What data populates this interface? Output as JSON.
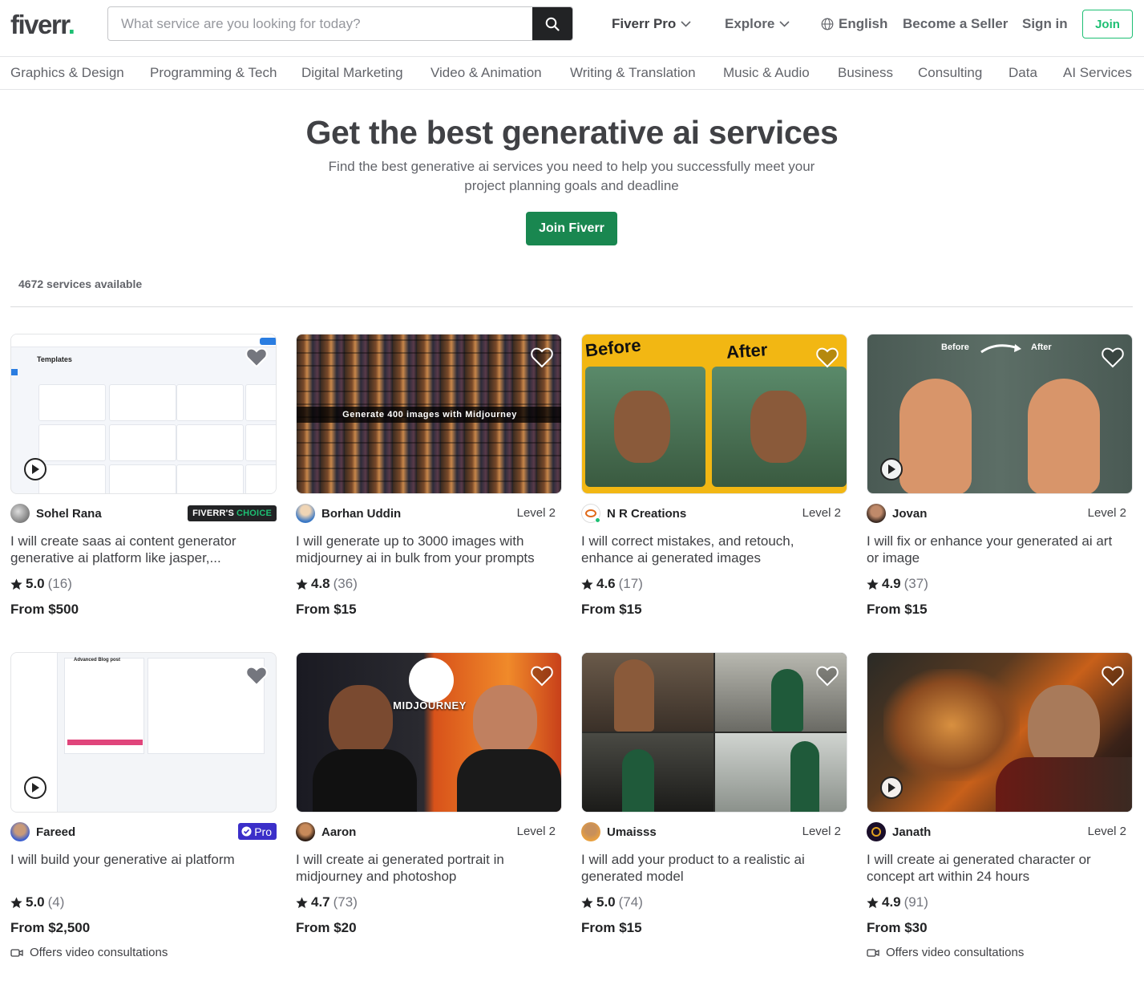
{
  "header": {
    "logo": "fiverr",
    "logo_dot": ".",
    "search_placeholder": "What service are you looking for today?",
    "fiverr_pro": "Fiverr Pro",
    "explore": "Explore",
    "language": "English",
    "become_seller": "Become a Seller",
    "sign_in": "Sign in",
    "join": "Join"
  },
  "categories": [
    "Graphics & Design",
    "Programming & Tech",
    "Digital Marketing",
    "Video & Animation",
    "Writing & Translation",
    "Music & Audio",
    "Business",
    "Consulting",
    "Data",
    "AI Services"
  ],
  "hero": {
    "title": "Get the best generative ai services",
    "subtitle": "Find the best generative ai services you need to help you successfully meet your project planning goals and deadline",
    "button": "Join Fiverr"
  },
  "services_count": "4672 services available",
  "gigs": [
    {
      "seller": "Sohel Rana",
      "badge": "FIVERR'S",
      "badge2": "CHOICE",
      "title": "I will create saas ai content generator generative ai platform like jasper,...",
      "score": "5.0",
      "count": "(16)",
      "price": "From $500",
      "thumb_text": "Templates"
    },
    {
      "seller": "Borhan Uddin",
      "level": "Level 2",
      "title": "I will generate up to 3000 images with midjourney ai in bulk from your prompts",
      "score": "4.8",
      "count": "(36)",
      "price": "From $15",
      "thumb_text": "Generate 400 images with Midjourney"
    },
    {
      "seller": "N R Creations",
      "level": "Level 2",
      "title": "I will correct mistakes, and retouch, enhance ai generated images",
      "score": "4.6",
      "count": "(17)",
      "price": "From $15",
      "thumb_text": "Before",
      "thumb_text2": "After"
    },
    {
      "seller": "Jovan",
      "level": "Level 2",
      "title": "I will fix or enhance your generated ai art or image",
      "score": "4.9",
      "count": "(37)",
      "price": "From $15",
      "thumb_text": "Before",
      "thumb_text2": "After"
    },
    {
      "seller": "Fareed",
      "badge": "Pro",
      "title": "I will build your generative ai platform",
      "score": "5.0",
      "count": "(4)",
      "price": "From $2,500",
      "extra": "Offers video consultations",
      "thumb_text": "Advanced Blog post"
    },
    {
      "seller": "Aaron",
      "level": "Level 2",
      "title": "I will create ai generated portrait in midjourney and photoshop",
      "score": "4.7",
      "count": "(73)",
      "price": "From $20",
      "thumb_text": "MIDJOURNEY"
    },
    {
      "seller": "Umaisss",
      "level": "Level 2",
      "title": "I will add your product to a realistic ai generated model",
      "score": "5.0",
      "count": "(74)",
      "price": "From $15"
    },
    {
      "seller": "Janath",
      "level": "Level 2",
      "title": "I will create ai generated character or concept art within 24 hours",
      "score": "4.9",
      "count": "(91)",
      "price": "From $30",
      "extra": "Offers video consultations"
    }
  ]
}
